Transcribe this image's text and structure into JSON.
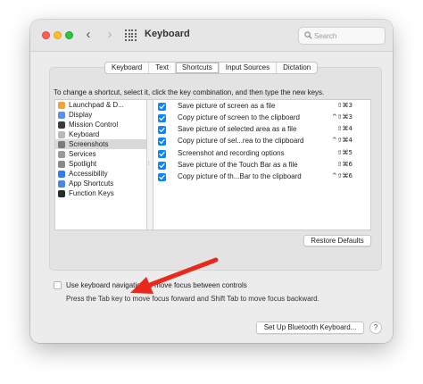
{
  "window": {
    "title": "Keyboard",
    "back_glyph": "‹",
    "forward_glyph": "›",
    "search_placeholder": "Search"
  },
  "tabs": [
    {
      "label": "Keyboard",
      "active": false
    },
    {
      "label": "Text",
      "active": false
    },
    {
      "label": "Shortcuts",
      "active": true
    },
    {
      "label": "Input Sources",
      "active": false
    },
    {
      "label": "Dictation",
      "active": false
    }
  ],
  "instructions": "To change a shortcut, select it, click the key combination, and then type the new keys.",
  "categories": [
    {
      "label": "Launchpad & D...",
      "icon": "launchpad-icon",
      "color": "#f0a33a",
      "selected": false
    },
    {
      "label": "Display",
      "icon": "display-icon",
      "color": "#5b8ff0",
      "selected": false
    },
    {
      "label": "Mission Control",
      "icon": "mission-control-icon",
      "color": "#3a3a3a",
      "selected": false
    },
    {
      "label": "Keyboard",
      "icon": "keyboard-icon",
      "color": "#b8b8b8",
      "selected": false
    },
    {
      "label": "Screenshots",
      "icon": "screenshots-icon",
      "color": "#7a7a7a",
      "selected": true
    },
    {
      "label": "Services",
      "icon": "services-icon",
      "color": "#9a9a9a",
      "selected": false
    },
    {
      "label": "Spotlight",
      "icon": "spotlight-icon",
      "color": "#8a8a8a",
      "selected": false
    },
    {
      "label": "Accessibility",
      "icon": "accessibility-icon",
      "color": "#2f7cf6",
      "selected": false
    },
    {
      "label": "App Shortcuts",
      "icon": "app-shortcuts-icon",
      "color": "#4a86e8",
      "selected": false
    },
    {
      "label": "Function Keys",
      "icon": "function-keys-icon",
      "color": "#2a2a2a",
      "selected": false
    }
  ],
  "shortcuts": [
    {
      "label": "Save picture of screen as a file",
      "keys": "⇧⌘3",
      "checked": true
    },
    {
      "label": "Copy picture of screen to the clipboard",
      "keys": "^⇧⌘3",
      "checked": true
    },
    {
      "label": "Save picture of selected area as a file",
      "keys": "⇧⌘4",
      "checked": true
    },
    {
      "label": "Copy picture of sel...rea to the clipboard",
      "keys": "^⇧⌘4",
      "checked": true
    },
    {
      "label": "Screenshot and recording options",
      "keys": "⇧⌘5",
      "checked": true
    },
    {
      "label": "Save picture of the Touch Bar as a file",
      "keys": "⇧⌘6",
      "checked": true
    },
    {
      "label": "Copy picture of th...Bar to the clipboard",
      "keys": "^⇧⌘6",
      "checked": true
    }
  ],
  "restore_defaults_label": "Restore Defaults",
  "keyboard_navigation": {
    "label": "Use keyboard navigation to move focus between controls",
    "checked": false,
    "hint": "Press the Tab key to move focus forward and Shift Tab to move focus backward."
  },
  "bluetooth_button_label": "Set Up Bluetooth Keyboard...",
  "help_label": "?",
  "colors": {
    "accent": "#0a84ff",
    "annotation_arrow": "#e8291c"
  }
}
